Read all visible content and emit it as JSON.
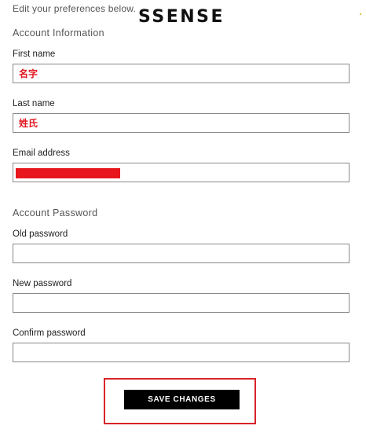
{
  "header": {
    "intro_text": "Edit your preferences below.",
    "logo_text": "SSENSE"
  },
  "account_information": {
    "heading": "Account Information",
    "first_name": {
      "label": "First name",
      "value": "名字"
    },
    "last_name": {
      "label": "Last name",
      "value": "姓氏"
    },
    "email": {
      "label": "Email address",
      "value": ""
    },
    "redaction_color": "#e8161d"
  },
  "account_password": {
    "heading": "Account Password",
    "old_password": {
      "label": "Old password",
      "value": ""
    },
    "new_password": {
      "label": "New password",
      "value": ""
    },
    "confirm_password": {
      "label": "Confirm password",
      "value": ""
    }
  },
  "actions": {
    "save_label": "SAVE CHANGES",
    "highlight_color": "#d8232a"
  }
}
